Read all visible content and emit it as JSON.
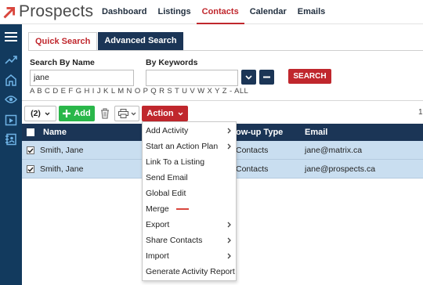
{
  "app": {
    "name": "Prospects"
  },
  "nav": {
    "items": [
      {
        "label": "Dashboard",
        "active": false
      },
      {
        "label": "Listings",
        "active": false
      },
      {
        "label": "Contacts",
        "active": true
      },
      {
        "label": "Calendar",
        "active": false
      },
      {
        "label": "Emails",
        "active": false
      }
    ]
  },
  "sidebar": {
    "icons": [
      "menu-icon",
      "trending-icon",
      "home-icon",
      "eye-icon",
      "calendar-play-icon",
      "contacts-book-icon"
    ]
  },
  "tabs": [
    {
      "label": "Quick Search",
      "active": true
    },
    {
      "label": "Advanced Search",
      "active": false
    }
  ],
  "search": {
    "name_label": "Search By Name",
    "name_value": "jane",
    "keywords_label": "By Keywords",
    "keywords_value": "",
    "search_button": "SEARCH",
    "alphabet": "A B C D E F G H I J K L M N O P Q R S T U V W X Y Z  -  ALL"
  },
  "toolbar": {
    "selected_count": "(2)",
    "add_label": "Add",
    "action_label": "Action",
    "page_number": "1"
  },
  "table": {
    "columns": {
      "name": "Name",
      "followup_type": "ow-up Type",
      "email": "Email"
    },
    "rows": [
      {
        "name": "Smith, Jane",
        "followup_type": "Contacts",
        "email": "jane@matrix.ca",
        "checked": true
      },
      {
        "name": "Smith, Jane",
        "followup_type": "Contacts",
        "email": "jane@prospects.ca",
        "checked": true
      }
    ]
  },
  "action_menu": {
    "items": [
      {
        "label": "Add Activity",
        "submenu": true
      },
      {
        "label": "Start an Action Plan",
        "submenu": true
      },
      {
        "label": "Link To a Listing",
        "submenu": false
      },
      {
        "label": "Send Email",
        "submenu": false
      },
      {
        "label": "Global Edit",
        "submenu": false
      },
      {
        "label": "Merge",
        "submenu": false
      },
      {
        "label": "Export",
        "submenu": true
      },
      {
        "label": "Share Contacts",
        "submenu": true
      },
      {
        "label": "Import",
        "submenu": true
      },
      {
        "label": "Generate Activity Report",
        "submenu": false
      }
    ]
  },
  "colors": {
    "brand_red": "#c0272d",
    "navy": "#1b3556",
    "sidebar": "#123a5e",
    "add_green": "#2ab74a",
    "selected_row": "#c9def0"
  }
}
